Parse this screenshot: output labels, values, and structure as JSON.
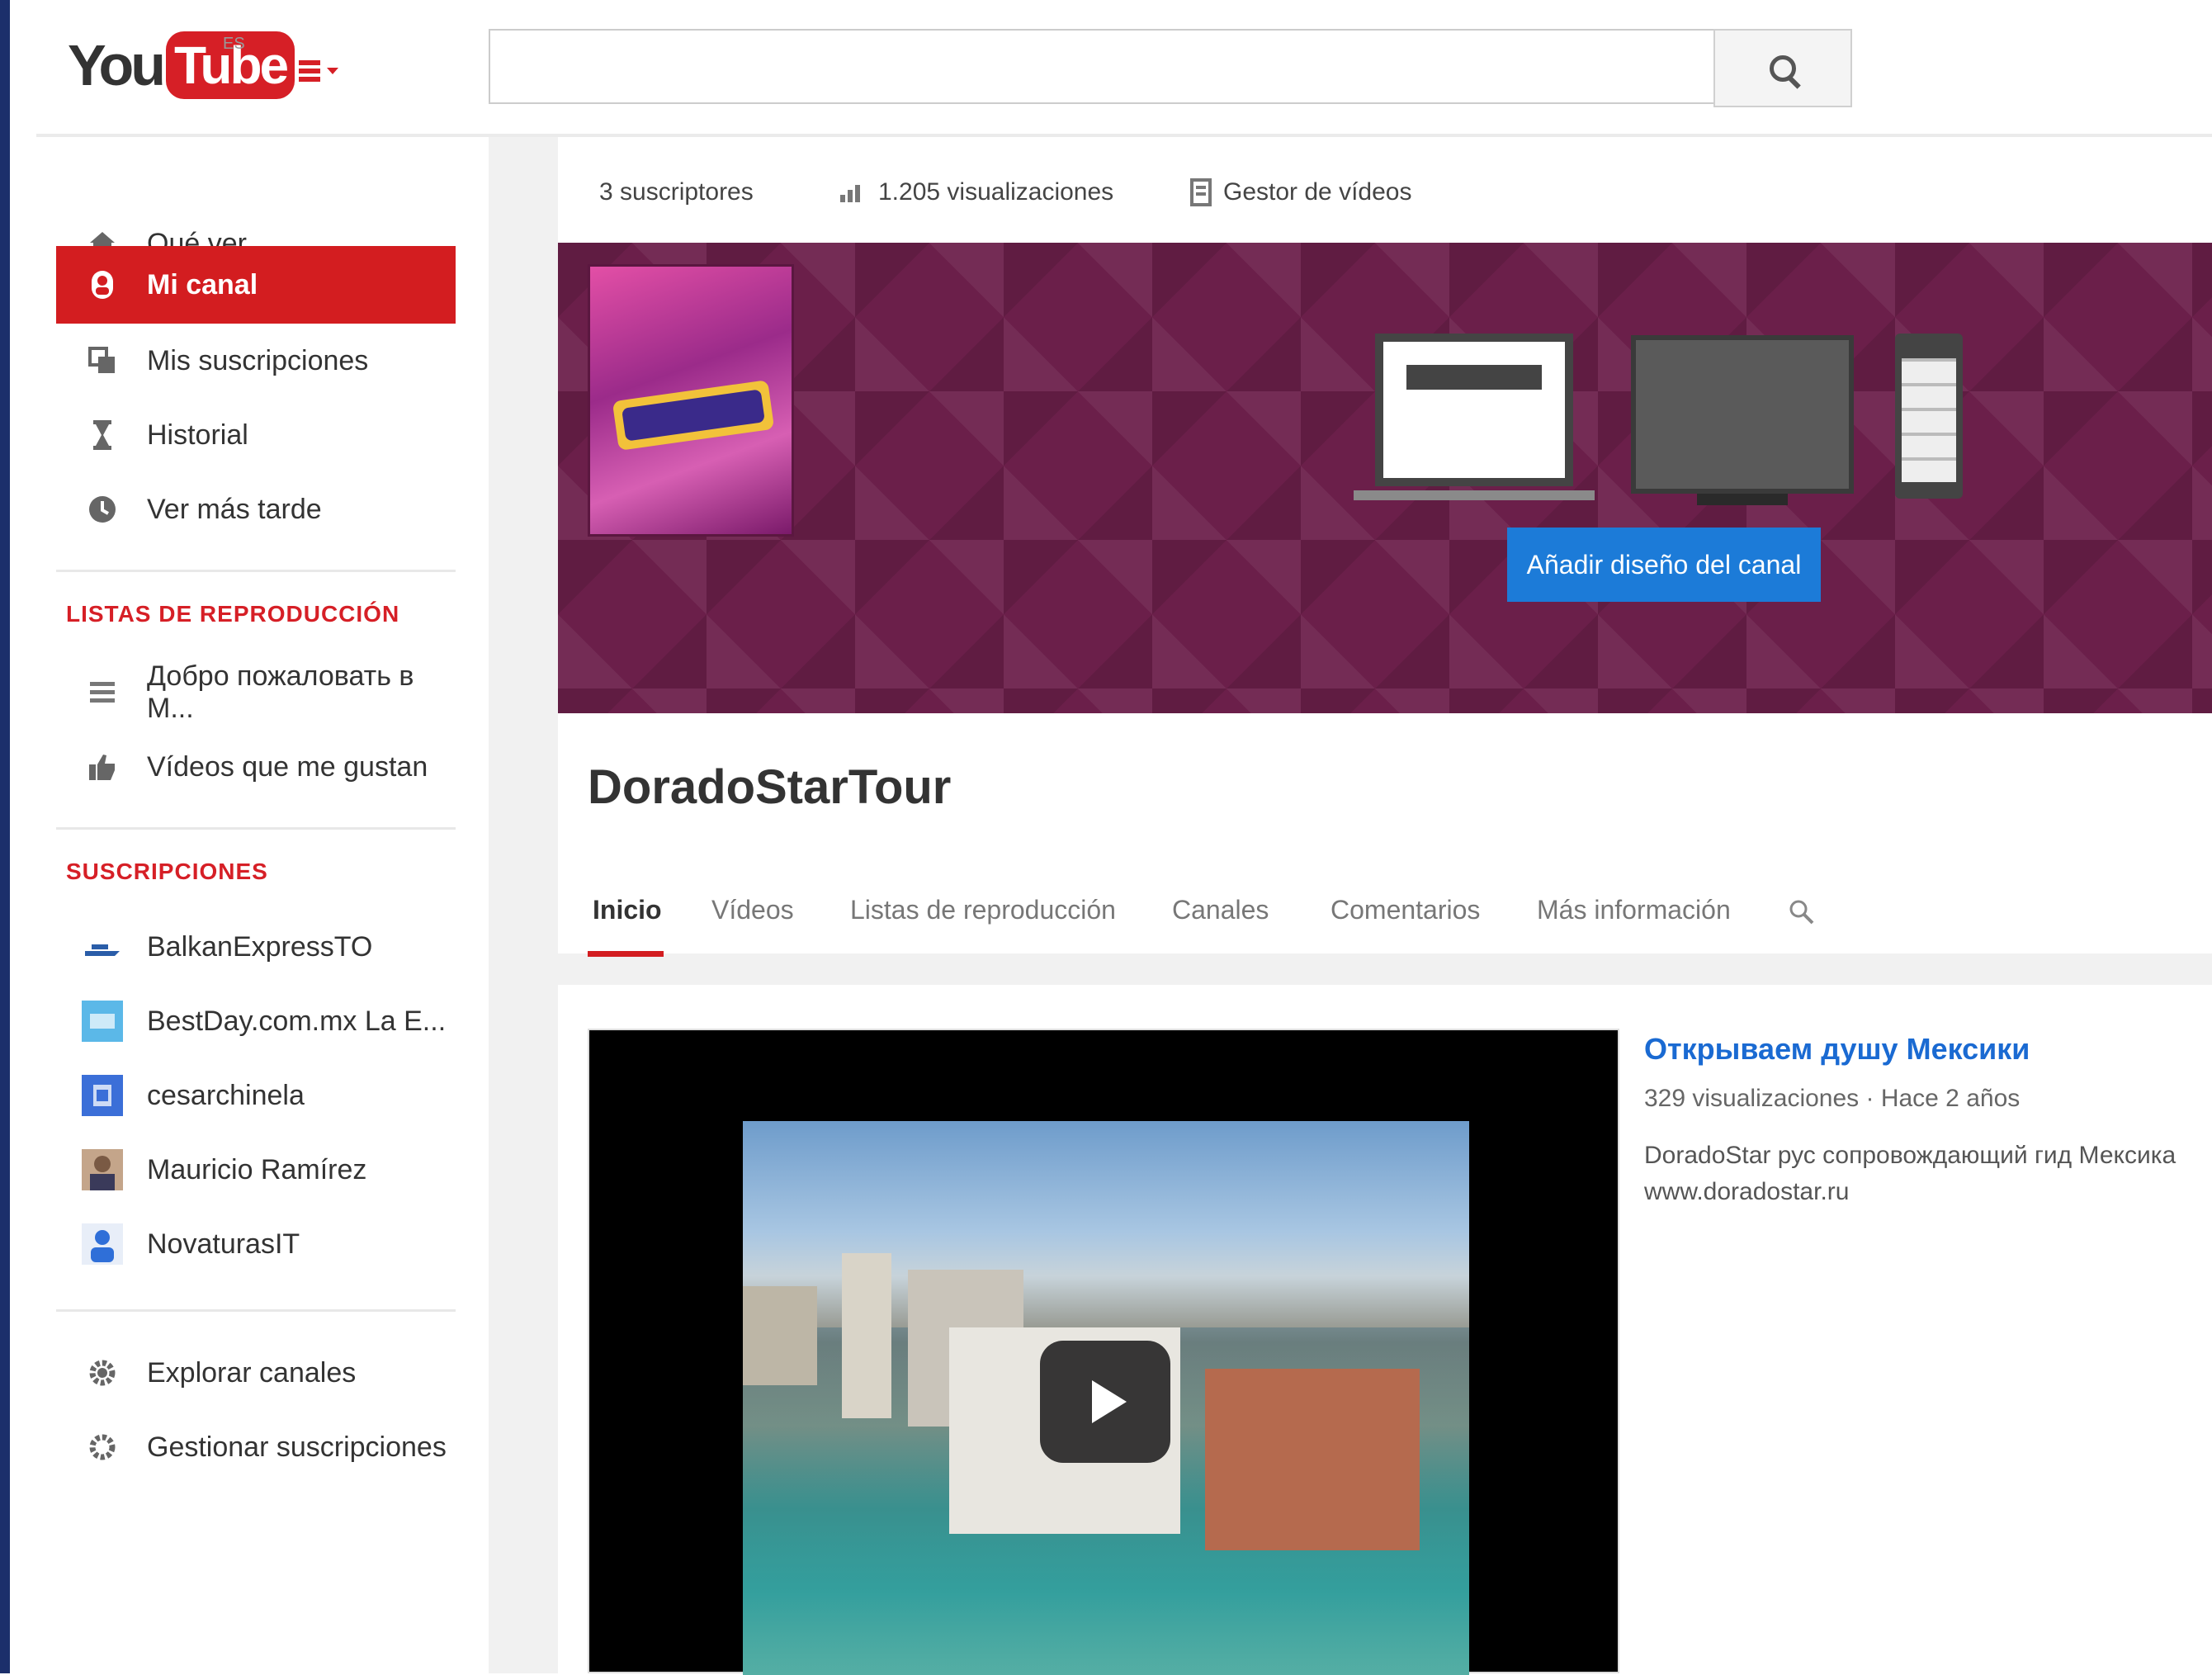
{
  "brand": {
    "logo_you": "You",
    "logo_tube": "Tube",
    "logo_region": "ES",
    "accent": "#d31d20"
  },
  "search": {
    "value": "",
    "placeholder": ""
  },
  "sidebar": {
    "main_items": [
      {
        "label": "Qué ver",
        "icon": "home-icon"
      },
      {
        "label": "Mi canal",
        "icon": "user-icon",
        "active": true
      },
      {
        "label": "Mis suscripciones",
        "icon": "subscriptions-icon"
      },
      {
        "label": "Historial",
        "icon": "hourglass-icon"
      },
      {
        "label": "Ver más tarde",
        "icon": "clock-icon"
      }
    ],
    "playlists_title": "LISTAS DE REPRODUCCIÓN",
    "playlists": [
      {
        "label": "Добро пожаловать в М...",
        "icon": "playlist-icon"
      },
      {
        "label": "Vídeos que me gustan",
        "icon": "thumbs-up-icon"
      }
    ],
    "subscriptions_title": "SUSCRIPCIONES",
    "subscriptions": [
      {
        "label": "BalkanExpressTO"
      },
      {
        "label": "BestDay.com.mx La E..."
      },
      {
        "label": "cesarchinela"
      },
      {
        "label": "Mauricio Ramírez"
      },
      {
        "label": "NovaturasIT"
      }
    ],
    "footer_items": [
      {
        "label": "Explorar canales",
        "icon": "gear-icon"
      },
      {
        "label": "Gestionar suscripciones",
        "icon": "gear-icon"
      }
    ]
  },
  "stats": {
    "subscribers": "3 suscriptores",
    "views": "1.205 visualizaciones",
    "video_manager": "Gestor de vídeos"
  },
  "banner": {
    "customize_label": "Añadir diseño del canal",
    "color": "#6b1f4a"
  },
  "channel": {
    "title": "DoradoStarTour"
  },
  "tabs": [
    "Inicio",
    "Vídeos",
    "Listas de reproducción",
    "Canales",
    "Comentarios",
    "Más información"
  ],
  "featured_video": {
    "title": "Открываем душу Мексики",
    "meta": "329 visualizaciones · Hace 2 años",
    "description_line1": "DoradoStar рус сопровождающий гид Мексика",
    "description_line2": "www.doradostar.ru"
  }
}
